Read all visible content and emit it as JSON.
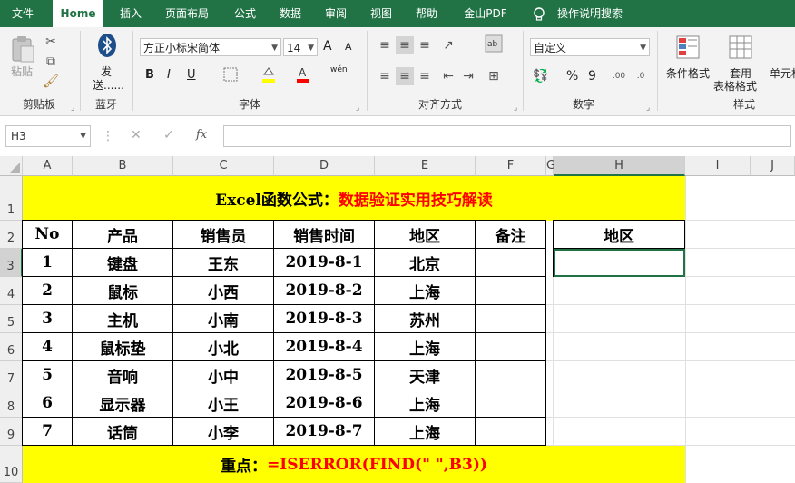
{
  "tabs": [
    "文件",
    "Home",
    "插入",
    "页面布局",
    "公式",
    "数据",
    "审阅",
    "视图",
    "帮助",
    "金山PDF",
    "操作说明搜索"
  ],
  "ribbon": {
    "clipboard": {
      "paste": "粘贴",
      "label": "剪贴板"
    },
    "bluetooth": {
      "send": "发",
      "send2": "送......",
      "label": "蓝牙"
    },
    "font": {
      "name": "方正小标宋简体",
      "size": "14",
      "label": "字体",
      "grow": "A",
      "shrink": "A",
      "bold": "B",
      "italic": "I",
      "underline": "U",
      "phonetic": "wén"
    },
    "alignment": {
      "label": "对齐方式"
    },
    "number": {
      "format": "自定义",
      "percent": "%",
      "comma": "9",
      "label": "数字"
    },
    "styles": {
      "conditional": "条件格式",
      "table_format_1": "套用",
      "table_format_2": "表格格式",
      "cell_styles": "单元格",
      "label": "样式"
    }
  },
  "formula_bar": {
    "name_box": "H3",
    "fx": "fx",
    "cancel": "✕",
    "enter": "✓"
  },
  "columns": [
    "A",
    "B",
    "C",
    "D",
    "E",
    "F",
    "G",
    "H",
    "I",
    "J"
  ],
  "rows": [
    "1",
    "2",
    "3",
    "4",
    "5",
    "6",
    "7",
    "8",
    "9",
    "10"
  ],
  "sheet": {
    "title_black": "Excel函数公式：",
    "title_red": "数据验证实用技巧解读",
    "headers": [
      "No",
      "产品",
      "销售员",
      "销售时间",
      "地区",
      "备注"
    ],
    "data": [
      [
        "1",
        "键盘",
        "王东",
        "2019-8-1",
        "北京",
        ""
      ],
      [
        "2",
        "鼠标",
        "小西",
        "2019-8-2",
        "上海",
        ""
      ],
      [
        "3",
        "主机",
        "小南",
        "2019-8-3",
        "苏州",
        ""
      ],
      [
        "4",
        "鼠标垫",
        "小北",
        "2019-8-4",
        "上海",
        ""
      ],
      [
        "5",
        "音响",
        "小中",
        "2019-8-5",
        "天津",
        ""
      ],
      [
        "6",
        "显示器",
        "小王",
        "2019-8-6",
        "上海",
        ""
      ],
      [
        "7",
        "话筒",
        "小李",
        "2019-8-7",
        "上海",
        ""
      ]
    ],
    "side_header": "地区",
    "side_value": "",
    "footer_black": "重点：",
    "footer_red": "=ISERROR(FIND(\" \",B3))"
  },
  "colors": {
    "accent": "#217346",
    "highlight": "#ffff00",
    "red": "#ff0000"
  }
}
